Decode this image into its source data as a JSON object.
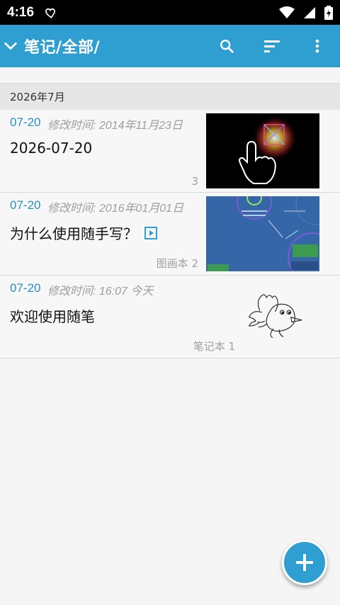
{
  "status_bar": {
    "time": "4:16"
  },
  "app_bar": {
    "title": "笔记/全部/"
  },
  "section": {
    "label": "2026年7月"
  },
  "notes": [
    {
      "date": "07-20",
      "modified": "修改时间: 2014年11月23日",
      "title": "2026-07-20",
      "count": "3"
    },
    {
      "date": "07-20",
      "modified": "修改时间: 2016年01月01日",
      "title": "为什么使用随手写？",
      "count": "图画本 2"
    },
    {
      "date": "07-20",
      "modified": "修改时间: 16:07 今天",
      "title": "欢迎使用随笔",
      "count": "笔记本 1"
    }
  ],
  "colors": {
    "primary": "#2f9fd1",
    "date_blue": "#2b8ec0"
  },
  "icons": [
    "chevron-down-icon",
    "search-icon",
    "sort-icon",
    "more-vert-icon",
    "add-icon",
    "play-icon"
  ]
}
